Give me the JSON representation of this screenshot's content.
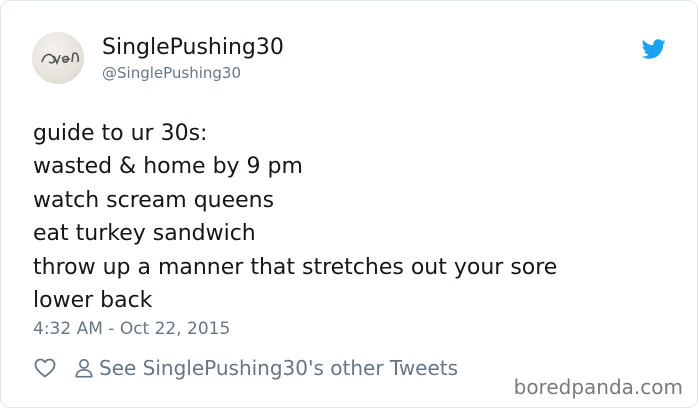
{
  "user": {
    "display_name": "SinglePushing30",
    "handle": "@SinglePushing30",
    "avatar_text": "eve n"
  },
  "tweet": {
    "lines": [
      "guide to ur 30s:",
      "wasted & home by 9 pm",
      "watch scream queens",
      "eat turkey sandwich",
      "throw up a manner that stretches out your sore",
      "lower back"
    ],
    "timestamp": "4:32 AM - Oct 22, 2015"
  },
  "actions": {
    "other_tweets_label": "See SinglePushing30's other Tweets"
  },
  "watermark": "boredpanda.com",
  "colors": {
    "twitter_blue": "#1da1f2",
    "secondary_text": "#657786",
    "primary_text": "#14171a"
  },
  "icons": [
    "twitter-bird-icon",
    "heart-icon",
    "person-icon"
  ]
}
